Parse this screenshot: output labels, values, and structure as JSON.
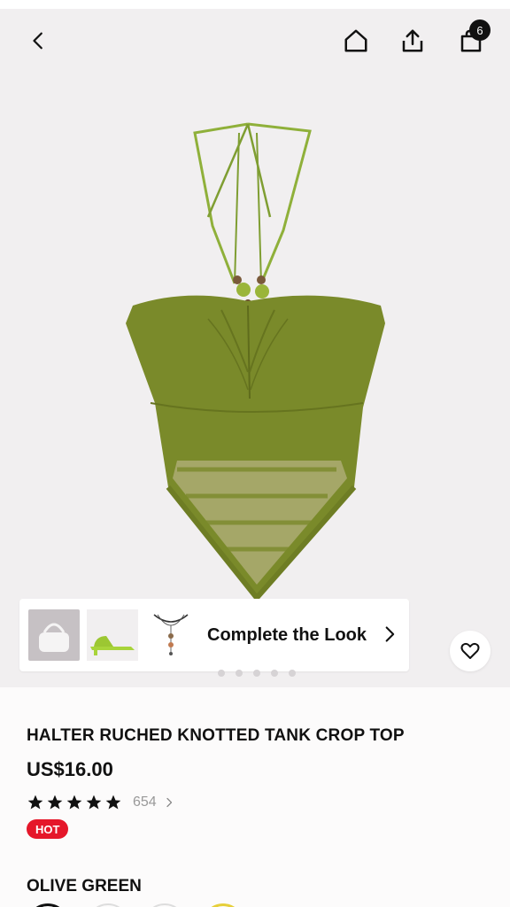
{
  "nav": {
    "back_icon": "chevron-left-icon",
    "home_icon": "home-icon",
    "share_icon": "share-icon",
    "bag_icon": "shopping-bag-icon",
    "bag_count": "6"
  },
  "gallery": {
    "product_image": "olive-green-halter-crop-top",
    "complete_look": {
      "label": "Complete the Look",
      "thumbnails": [
        "white-handbag",
        "lime-green-mule-sandal",
        "pendant-necklace"
      ]
    },
    "wishlist_icon": "heart-icon"
  },
  "product": {
    "title": "HALTER RUCHED KNOTTED TANK CROP TOP",
    "price": "US$16.00",
    "rating_stars": 5,
    "review_count": "654",
    "badge": "HOT",
    "color_label": "OLIVE GREEN"
  },
  "colors": {
    "accent_red": "#e5172a",
    "olive": "#7a8a2a",
    "text": "#111111"
  }
}
